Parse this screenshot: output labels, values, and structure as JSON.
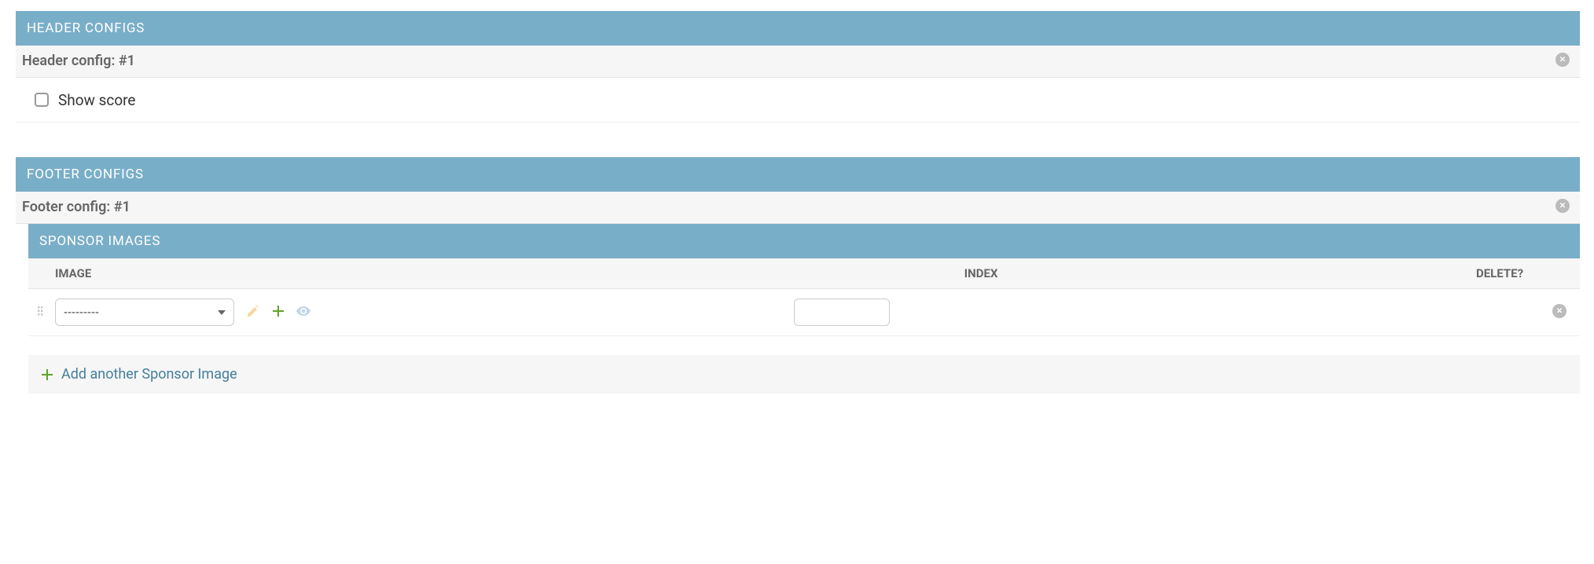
{
  "header_configs": {
    "title": "HEADER CONFIGS",
    "entry_label": "Header config:",
    "entry_number": "#1",
    "show_score_label": "Show score",
    "show_score_checked": false
  },
  "footer_configs": {
    "title": "FOOTER CONFIGS",
    "entry_label": "Footer config:",
    "entry_number": "#1",
    "sponsor_images": {
      "title": "SPONSOR IMAGES",
      "columns": {
        "image": "IMAGE",
        "index": "INDEX",
        "delete": "DELETE?"
      },
      "rows": [
        {
          "image_selected": "---------",
          "index_value": ""
        }
      ],
      "add_another_label": "Add another Sponsor Image"
    }
  }
}
